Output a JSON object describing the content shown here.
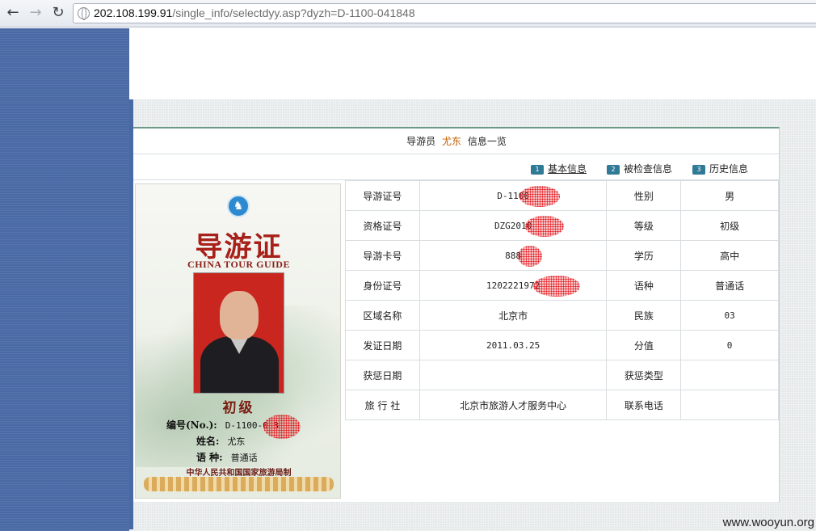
{
  "browser": {
    "back_icon": "back-arrow-icon",
    "forward_icon": "forward-arrow-icon",
    "reload_icon": "reload-icon",
    "url_host": "202.108.199.91",
    "url_path": "/single_info/selectdyy.asp?dyzh=D-1100-041848"
  },
  "header": {
    "title_prefix": "导游员",
    "guide_name": "尤东",
    "title_suffix": "信息一览"
  },
  "tabs": [
    {
      "num": "1",
      "label": "基本信息"
    },
    {
      "num": "2",
      "label": "被检查信息"
    },
    {
      "num": "3",
      "label": "历史信息"
    }
  ],
  "card": {
    "title": "导游证",
    "subtitle": "CHINA TOUR GUIDE",
    "level": "初级",
    "no_label": "编号(No.):",
    "no_value": "D-1100-0    3",
    "name_label": "姓名:",
    "name_value": "尤东",
    "lang_label": "语 种:",
    "lang_value": "普通话",
    "issuer": "中华人民共和国国家旅游局制"
  },
  "table": {
    "rows": [
      {
        "k1": "导游证号",
        "v1": "D-1100",
        "k2": "性别",
        "v2": "男"
      },
      {
        "k1": "资格证号",
        "v1": "DZG2010",
        "k2": "等级",
        "v2": "初级"
      },
      {
        "k1": "导游卡号",
        "v1": "888",
        "k2": "学历",
        "v2": "高中"
      },
      {
        "k1": "身份证号",
        "v1": "1202221972",
        "k2": "语种",
        "v2": "普通话"
      },
      {
        "k1": "区域名称",
        "v1": "北京市",
        "k2": "民族",
        "v2": "03"
      },
      {
        "k1": "发证日期",
        "v1": "2011.03.25",
        "k2": "分值",
        "v2": "0"
      },
      {
        "k1": "获惩日期",
        "v1": "",
        "k2": "获惩类型",
        "v2": ""
      },
      {
        "k1": "旅 行 社",
        "v1": "北京市旅游人才服务中心",
        "k2": "联系电话",
        "v2": ""
      }
    ]
  },
  "watermark": "www.wooyun.org"
}
